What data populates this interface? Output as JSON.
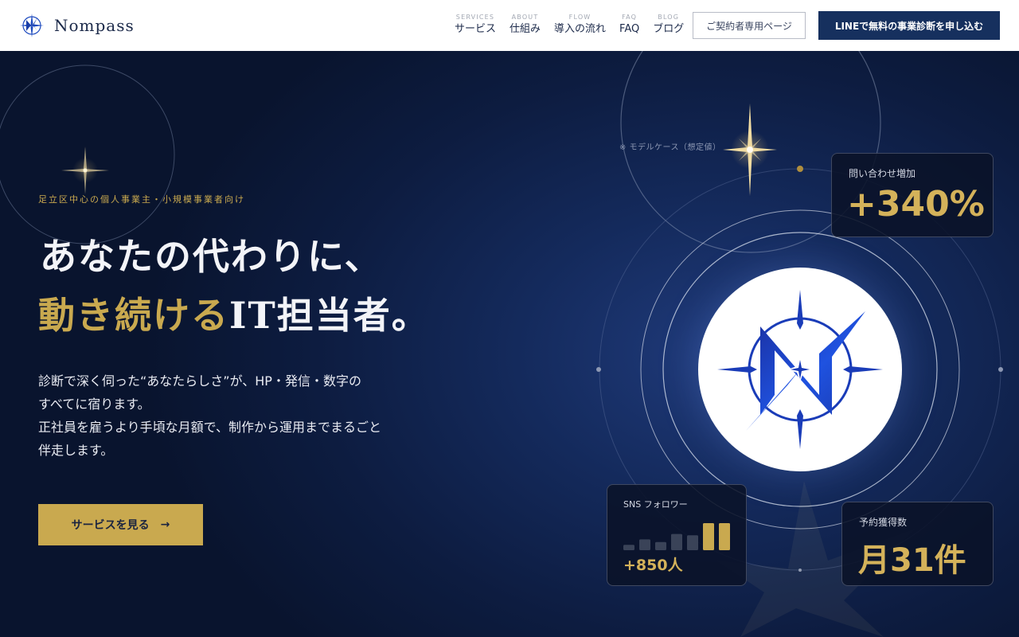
{
  "brand": {
    "name": "Nompass"
  },
  "nav": [
    {
      "en": "SERVICES",
      "ja": "サービス"
    },
    {
      "en": "ABOUT",
      "ja": "仕組み"
    },
    {
      "en": "FLOW",
      "ja": "導入の流れ"
    },
    {
      "en": "FAQ",
      "ja": "FAQ"
    },
    {
      "en": "BLOG",
      "ja": "ブログ"
    }
  ],
  "header": {
    "member_label": "ご契約者専用ページ",
    "line_label": "LINEで無料の事業診断を申し込む"
  },
  "hero": {
    "eyebrow": "足立区中心の個人事業主・小規模事業者向け",
    "headline_1": "あなたの代わりに、",
    "headline_2_gold": "動き続ける",
    "headline_2_white": "IT担当者。",
    "lead": [
      "診断で深く伺った“あなたらしさ”が、HP・発信・数字の",
      "すべてに宿ります。",
      "正社員を雇うより手頃な月額で、制作から運用までまるごと",
      "伴走します。"
    ],
    "cta_label": "サービスを見る",
    "cta_arrow": "→"
  },
  "stats": {
    "note": "※ モデルケース（想定値）",
    "inquiry": {
      "label": "問い合わせ増加",
      "value": "+340%"
    },
    "sns": {
      "label": "SNS フォロワー",
      "value": "+850人",
      "bar_levels": [
        0.2,
        0.4,
        0.3,
        0.6,
        0.55,
        1.0,
        1.0
      ]
    },
    "reservation": {
      "label": "予約獲得数",
      "value": "月31件"
    }
  },
  "colors": {
    "navy": "#16305e",
    "gold": "#c9a94f",
    "emblem_blue": "#1f4fd6"
  }
}
